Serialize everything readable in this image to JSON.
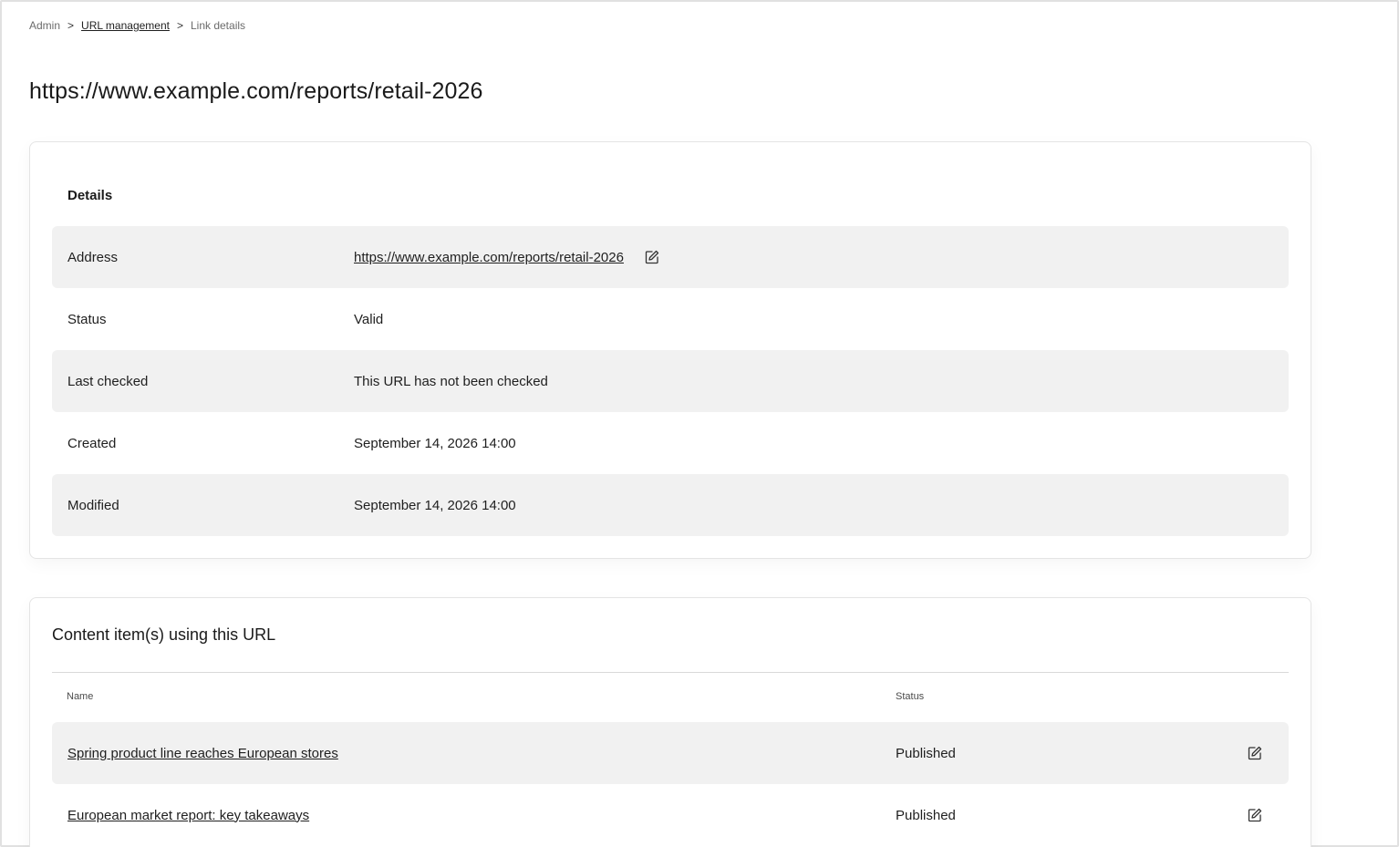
{
  "breadcrumb": {
    "root": "Admin",
    "separator": ">",
    "parent": "URL management",
    "current": "Link details"
  },
  "page": {
    "title": "https://www.example.com/reports/retail-2026"
  },
  "details": {
    "heading": "Details",
    "rows": [
      {
        "label": "Address",
        "value": "https://www.example.com/reports/retail-2026"
      },
      {
        "label": "Status",
        "value": "Valid"
      },
      {
        "label": "Last checked",
        "value": "This URL has not been checked"
      },
      {
        "label": "Created",
        "value": "September 14, 2026 14:00"
      },
      {
        "label": "Modified",
        "value": "September 14, 2026 14:00"
      }
    ]
  },
  "content_items": {
    "heading": "Content item(s) using this URL",
    "columns": {
      "name": "Name",
      "status": "Status"
    },
    "rows": [
      {
        "name": "Spring product line reaches European stores",
        "status": "Published"
      },
      {
        "name": "European market report: key takeaways",
        "status": "Published"
      }
    ]
  },
  "icons": {
    "edit": "pencil-edit-icon"
  }
}
